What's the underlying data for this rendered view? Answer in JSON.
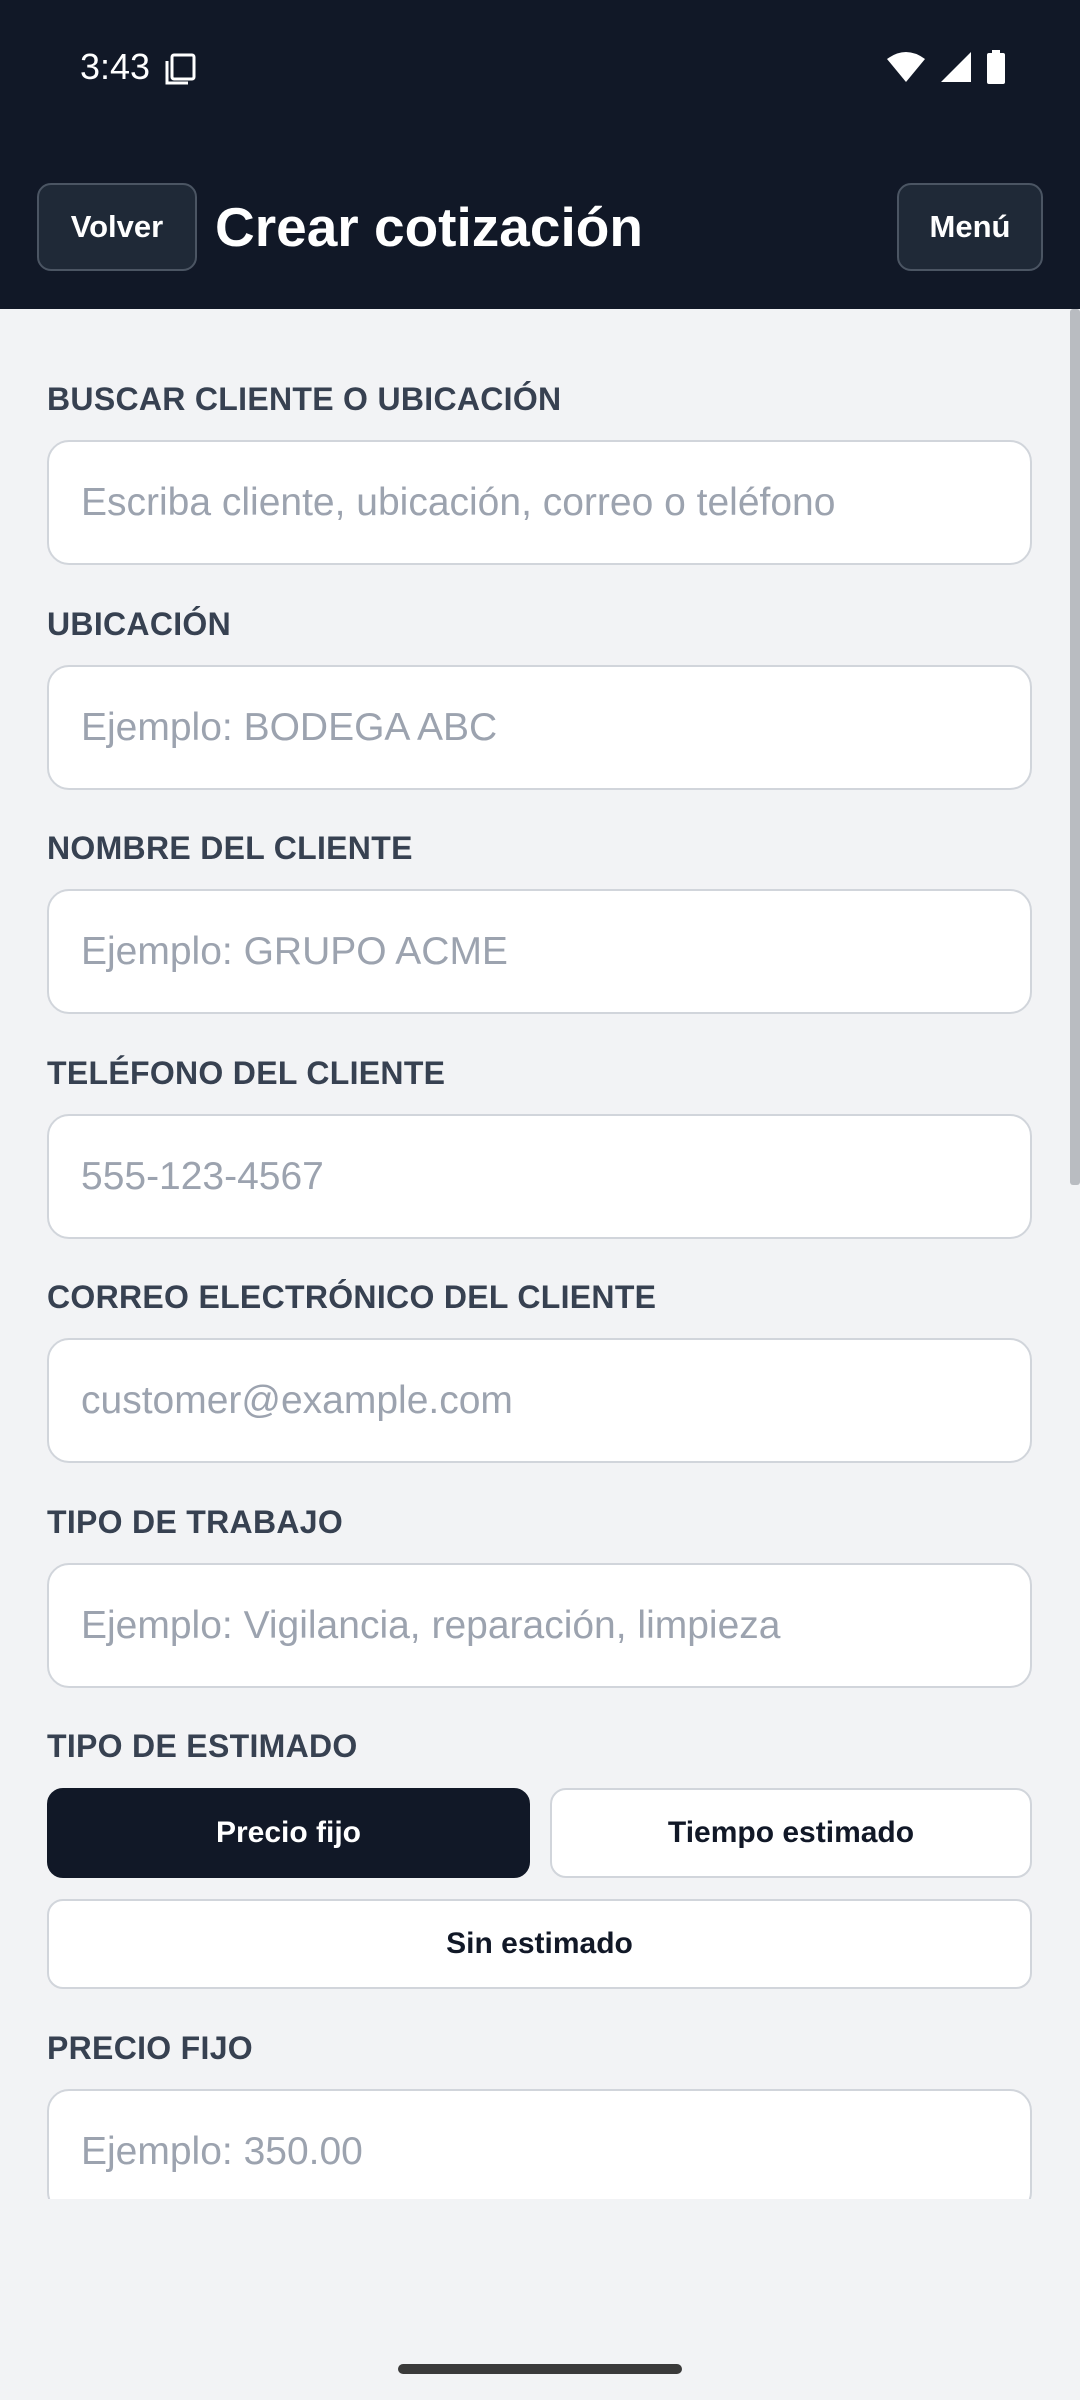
{
  "status_bar": {
    "time": "3:43",
    "icons": [
      "clipboard-icon",
      "wifi-icon",
      "cellular-signal-icon",
      "battery-icon"
    ]
  },
  "app_bar": {
    "back_label": "Volver",
    "title": "Crear cotización",
    "menu_label": "Menú"
  },
  "form": {
    "search": {
      "label": "BUSCAR CLIENTE O UBICACIÓN",
      "value": "",
      "placeholder": "Escriba cliente, ubicación, correo o teléfono"
    },
    "location": {
      "label": "UBICACIÓN",
      "value": "",
      "placeholder": "Ejemplo: BODEGA ABC"
    },
    "client_name": {
      "label": "NOMBRE DEL CLIENTE",
      "value": "",
      "placeholder": "Ejemplo: GRUPO ACME"
    },
    "client_phone": {
      "label": "TELÉFONO DEL CLIENTE",
      "value": "",
      "placeholder": "555-123-4567"
    },
    "client_email": {
      "label": "CORREO ELECTRÓNICO DEL CLIENTE",
      "value": "",
      "placeholder": "customer@example.com"
    },
    "job_type": {
      "label": "TIPO DE TRABAJO",
      "value": "",
      "placeholder": "Ejemplo: Vigilancia, reparación, limpieza"
    },
    "estimate_type": {
      "label": "TIPO DE ESTIMADO",
      "options": [
        "Precio fijo",
        "Tiempo estimado",
        "Sin estimado"
      ],
      "selected": "Precio fijo"
    },
    "fixed_price": {
      "label": "PRECIO FIJO",
      "value": "",
      "placeholder": "Ejemplo: 350.00"
    }
  },
  "colors": {
    "header_bg": "#111827",
    "page_bg": "#f2f3f5",
    "label": "#374151",
    "input_border": "#d1d5db",
    "placeholder": "#9ca3af",
    "active_button": "#111827"
  }
}
